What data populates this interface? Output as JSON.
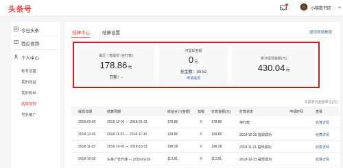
{
  "header": {
    "logo": "头条号",
    "username": "小猫数书区"
  },
  "sidebar": {
    "items": [
      {
        "label": "今日头条"
      },
      {
        "label": "西瓜视频"
      },
      {
        "label": "个人中心"
      }
    ],
    "subitems": [
      {
        "label": "帐号设置"
      },
      {
        "label": "我的收益"
      },
      {
        "label": "我的粉丝"
      },
      {
        "label": "结算提现"
      },
      {
        "label": "号外推广"
      }
    ]
  },
  "tabs": [
    {
      "label": "结算中心"
    },
    {
      "label": "结算设置"
    }
  ],
  "video_link": "提现视频教程",
  "cards": {
    "recent": {
      "label": "最近一笔提现 (含打款)",
      "value": "178.86",
      "unit": "元",
      "date": "日期：-"
    },
    "available": {
      "label": "可提现金额",
      "value": "0",
      "unit": "元",
      "total": "总金额：30.52",
      "link": "申请提现"
    },
    "cumulative": {
      "label": "累计提现金额(元)",
      "value": "430.04",
      "unit": "元"
    }
  },
  "note": "本报表内金额单位(元)",
  "table": {
    "headers": [
      "提现日期",
      "结算周期",
      "收益合计(金额)",
      "扣税",
      "打款金额(元)",
      "打款状态",
      "申请时间",
      "查看"
    ],
    "rows": [
      [
        "2018-02-02",
        "2018-12-01 --- 2018-01-31",
        "178.86",
        "0",
        "178.86",
        "待打款",
        "",
        "结算详情"
      ],
      [
        "2018-12-02",
        "2018-11-01 --- 2018-11-30",
        "129.85",
        "0",
        "129.85",
        "2018-12-20 提现成功",
        "",
        "结算详情"
      ],
      [
        "2018-11-02",
        "2018-10-01 --- 2018-10-31",
        "198.28",
        "0",
        "198.28",
        "2018-11-21 提现成功",
        "",
        "结算详情"
      ],
      [
        "2018-10-02",
        "头条广告开通 --- 2018-09-30",
        "113.81",
        "0",
        "113.81",
        "2018-10-23 提现成功",
        "",
        "结算详情"
      ]
    ]
  }
}
